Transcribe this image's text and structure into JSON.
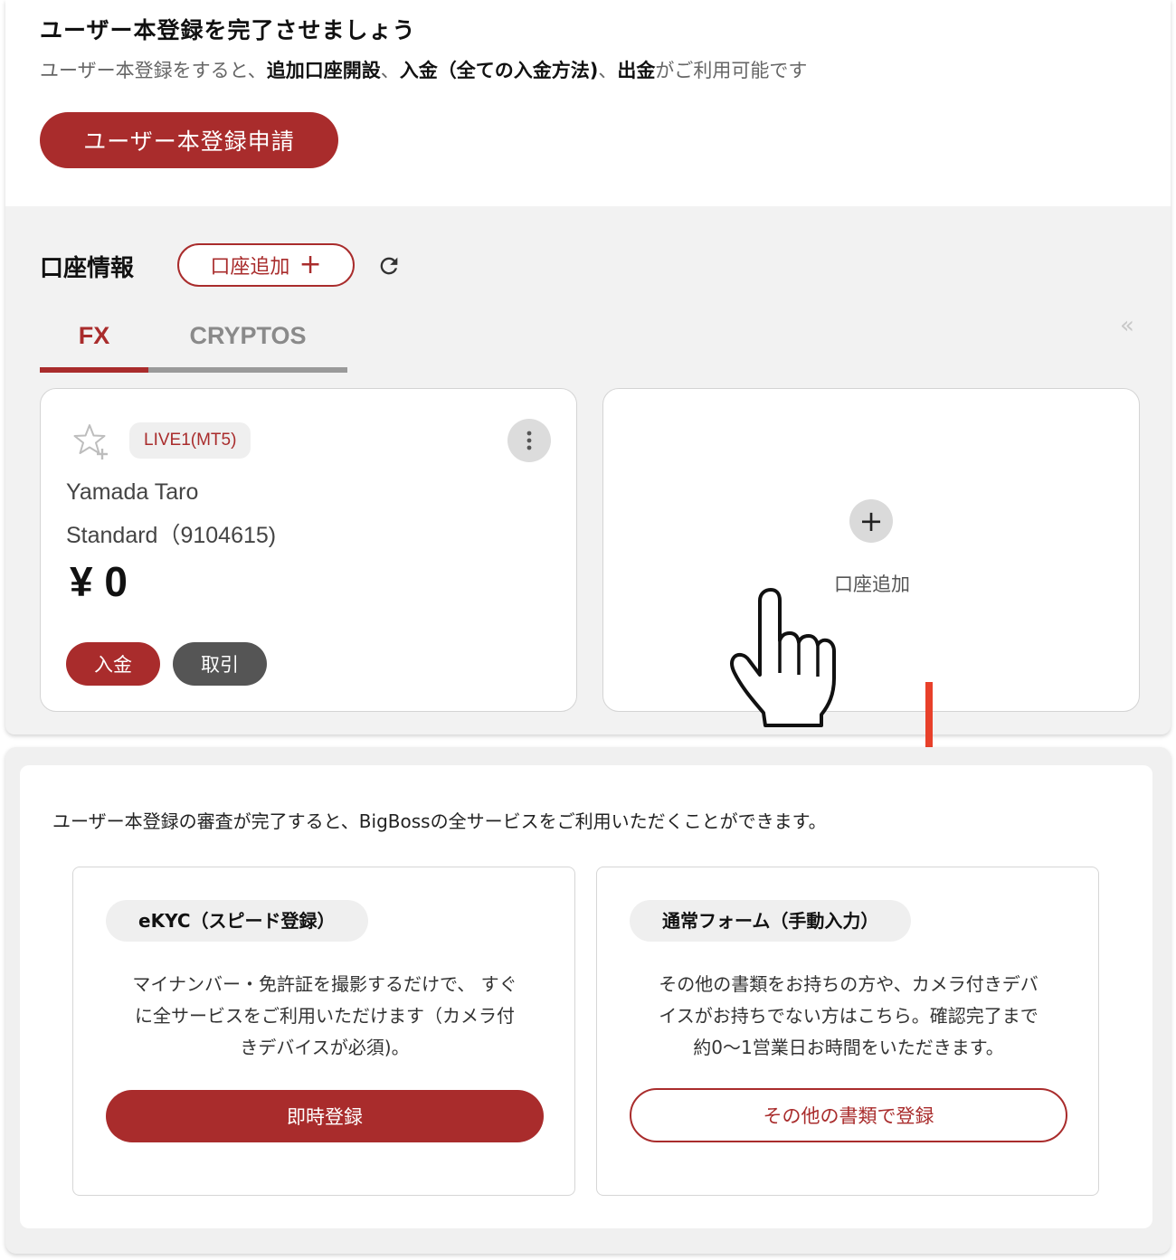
{
  "registration": {
    "title": "ユーザー本登録を完了させましょう",
    "desc_pre": "ユーザー本登録をすると、",
    "desc_b1": "追加口座開設",
    "desc_sep1": "、",
    "desc_b2": "入金（全ての入金方法)",
    "desc_sep2": "、",
    "desc_b3": "出金",
    "desc_post": "がご利用可能です",
    "button": "ユーザー本登録申請"
  },
  "account_section": {
    "heading": "口座情報",
    "add_button": "口座追加",
    "add_plus": "+",
    "collapse": "«"
  },
  "tabs": [
    {
      "label": "FX",
      "active": true
    },
    {
      "label": "CRYPTOS",
      "active": false
    }
  ],
  "account_card": {
    "badge": "LIVE1(MT5)",
    "holder": "Yamada Taro",
    "type": "Standard（9104615)",
    "currency": "¥",
    "balance": "0",
    "deposit": "入金",
    "trade": "取引"
  },
  "add_card": {
    "plus": "+",
    "label": "口座追加"
  },
  "kyc": {
    "message": "ユーザー本登録の審査が完了すると、BigBossの全サービスをご利用いただくことができます。",
    "ekyc": {
      "chip": "eKYC（スピード登録）",
      "line1": "マイナンバー・免許証を撮影するだけで、 すぐ",
      "line2": "に全サービスをご利用いただけます（カメラ付",
      "line3": "きデバイスが必須)。",
      "button": "即時登録"
    },
    "manual": {
      "chip": "通常フォーム（手動入力）",
      "line1": "その他の書類をお持ちの方や、カメラ付きデバ",
      "line2": "イスがお持ちでない方はこちら。確認完了まで",
      "line3": "約0〜1営業日お時間をいただきます。",
      "button": "その他の書類で登録"
    }
  },
  "colors": {
    "brand": "#a92c2c",
    "arrow": "#e8402a"
  }
}
